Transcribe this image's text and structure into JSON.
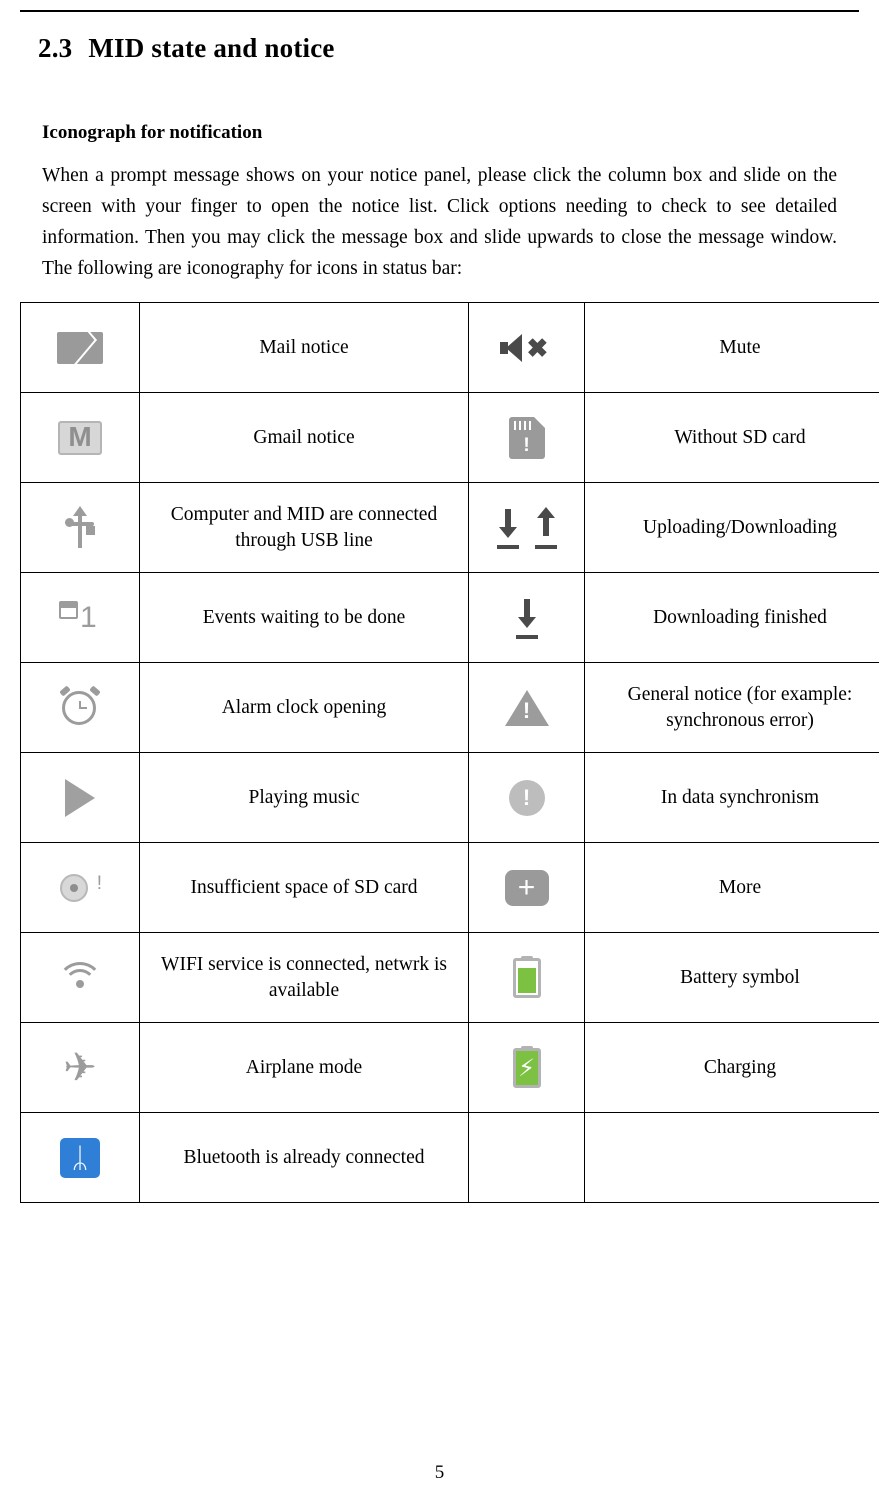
{
  "document": {
    "section_number": "2.3",
    "section_title": "MID state and notice",
    "subheading": "Iconograph for notification",
    "paragraph": "When a prompt message shows on your notice panel, please click the column box and slide on the screen with your finger to open the notice list. Click options needing to check to see detailed information. Then you may click the message box and slide upwards to close the message window. The following are iconography for icons in status bar:",
    "page_number": "5"
  },
  "table": {
    "rows": [
      {
        "left_icon": "mail-envelope-icon",
        "left_label": "Mail notice",
        "right_icon": "mute-speaker-icon",
        "right_label": "Mute"
      },
      {
        "left_icon": "gmail-icon",
        "left_label": "Gmail notice",
        "right_icon": "no-sd-card-icon",
        "right_label": "Without SD card"
      },
      {
        "left_icon": "usb-icon",
        "left_label": "Computer and MID are connected through USB line",
        "right_icon": "upload-download-arrows-icon",
        "right_label": "Uploading/Downloading"
      },
      {
        "left_icon": "calendar-event-icon",
        "left_label": "Events waiting to be done",
        "right_icon": "download-finished-icon",
        "right_label": "Downloading finished"
      },
      {
        "left_icon": "alarm-clock-icon",
        "left_label": "Alarm clock opening",
        "right_icon": "warning-triangle-icon",
        "right_label": "General notice (for example: synchronous error)"
      },
      {
        "left_icon": "play-music-icon",
        "left_label": "Playing music",
        "right_icon": "sync-error-icon",
        "right_label": "In data synchronism"
      },
      {
        "left_icon": "sd-card-low-space-icon",
        "left_label": "Insufficient space of SD card",
        "right_icon": "more-plus-icon",
        "right_label": "More"
      },
      {
        "left_icon": "wifi-icon",
        "left_label": "WIFI service is connected, netwrk is available",
        "right_icon": "battery-icon",
        "right_label": "Battery symbol"
      },
      {
        "left_icon": "airplane-mode-icon",
        "left_label": "Airplane mode",
        "right_icon": "charging-battery-icon",
        "right_label": "Charging"
      },
      {
        "left_icon": "bluetooth-icon",
        "left_label": "Bluetooth is already connected",
        "right_icon": "",
        "right_label": ""
      }
    ]
  },
  "icons": {
    "gmail_letter": "M",
    "mute_x": "✖",
    "nosd_mark": "!",
    "warn_bang": "!",
    "sync_bang": "!",
    "more_plus": "+",
    "bluetooth_glyph": "ᛦ",
    "airplane_glyph": "✈",
    "charge_bolt": "⚡",
    "events_number": "1",
    "sdlow_bang": "!"
  },
  "colors": {
    "icon_gray": "#9a9a9a",
    "bluetooth_blue": "#2f7fd6",
    "battery_green": "#7cc142",
    "dark_gray": "#4a4a4a"
  }
}
